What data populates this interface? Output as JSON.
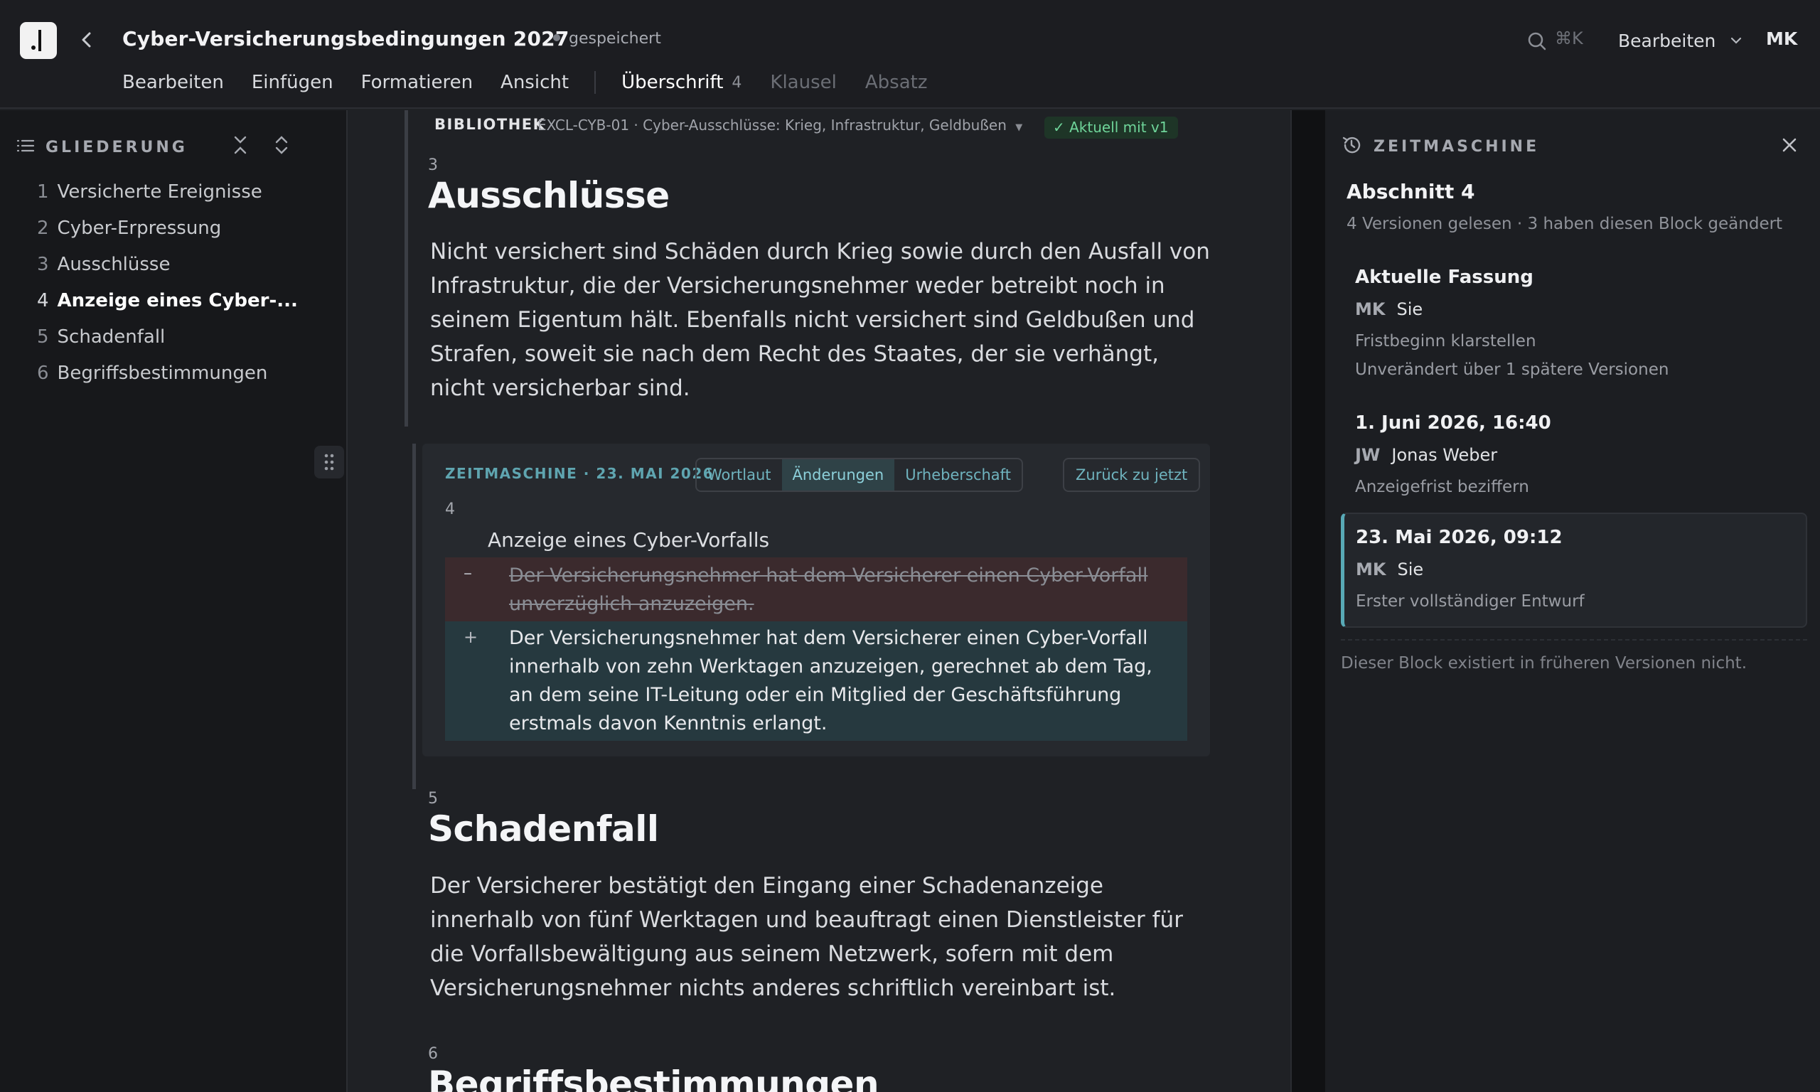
{
  "app": {
    "doc_title": "Cyber-Versicherungsbedingungen 2027",
    "save_status": "gespeichert",
    "search_shortcut": "⌘K",
    "mode": "Bearbeiten",
    "user_initials": "MK"
  },
  "menu": {
    "items": [
      "Bearbeiten",
      "Einfügen",
      "Formatieren",
      "Ansicht"
    ],
    "block_types": {
      "active": "Überschrift",
      "active_count": "4",
      "others": [
        "Klausel",
        "Absatz"
      ]
    }
  },
  "outline": {
    "title": "GLIEDERUNG",
    "items": [
      {
        "num": "1",
        "label": "Versicherte Ereignisse"
      },
      {
        "num": "2",
        "label": "Cyber-Erpressung"
      },
      {
        "num": "3",
        "label": "Ausschlüsse"
      },
      {
        "num": "4",
        "label": "Anzeige eines Cyber-..."
      },
      {
        "num": "5",
        "label": "Schadenfall"
      },
      {
        "num": "6",
        "label": "Begriffsbestimmungen"
      }
    ]
  },
  "library": {
    "label": "BIBLIOTHEK",
    "ref": "EXCL-CYB-01 · Cyber-Ausschlüsse: Krieg, Infrastruktur, Geldbußen",
    "status": "Aktuell mit v1"
  },
  "sections": {
    "s3": {
      "num": "3",
      "title": "Ausschlüsse",
      "body": "Nicht versichert sind Schäden durch Krieg sowie durch den Ausfall von Infrastruktur, die der Versicherungsnehmer weder betreibt noch in seinem Eigentum hält. Ebenfalls nicht versichert sind Geldbußen und Strafen, soweit sie nach dem Recht des Staates, der sie verhängt, nicht versicherbar sind."
    },
    "s5": {
      "num": "5",
      "title": "Schadenfall",
      "body": "Der Versicherer bestätigt den Eingang einer Schadenanzeige innerhalb von fünf Werktagen und beauftragt einen Dienstleister für die Vorfallsbewältigung aus seinem Netzwerk, sofern mit dem Versicherungsnehmer nichts anderes schriftlich vereinbart ist."
    },
    "s6": {
      "num": "6",
      "title": "Begriffsbestimmungen"
    }
  },
  "timemachine_block": {
    "label": "ZEITMASCHINE · 23. MAI 2026",
    "tabs": [
      "Wortlaut",
      "Änderungen",
      "Urheberschaft"
    ],
    "active_tab": "Änderungen",
    "back_button": "Zurück zu jetzt",
    "num": "4",
    "heading": "Anzeige eines Cyber-Vorfalls",
    "removed_marker": "–",
    "removed": "Der Versicherungsnehmer hat dem Versicherer einen Cyber-Vorfall unverzüglich anzuzeigen.",
    "added_marker": "+",
    "added": "Der Versicherungsnehmer hat dem Versicherer einen Cyber-Vorfall innerhalb von zehn Werktagen anzuzeigen, gerechnet ab dem Tag, an dem seine IT-Leitung oder ein Mitglied der Geschäftsführung erstmals davon Kenntnis erlangt.",
    "colors": {
      "accent": "#5fa5b0",
      "removed_bg": "#3b2a2d",
      "added_bg": "#26393f"
    }
  },
  "panel": {
    "title": "ZEITMASCHINE",
    "section": "Abschnitt 4",
    "summary": "4 Versionen gelesen · 3 haben diesen Block geändert",
    "versions": [
      {
        "title": "Aktuelle Fassung",
        "initials": "MK",
        "author": "Sie",
        "message": "Fristbeginn klarstellen",
        "note": "Unverändert über 1 spätere Versionen"
      },
      {
        "title": "1. Juni 2026, 16:40",
        "initials": "JW",
        "author": "Jonas Weber",
        "message": "Anzeigefrist beziffern"
      },
      {
        "title": "23. Mai 2026, 09:12",
        "initials": "MK",
        "author": "Sie",
        "message": "Erster vollständiger Entwurf",
        "selected": true
      }
    ],
    "footer_note": "Dieser Block existiert in früheren Versionen nicht."
  }
}
